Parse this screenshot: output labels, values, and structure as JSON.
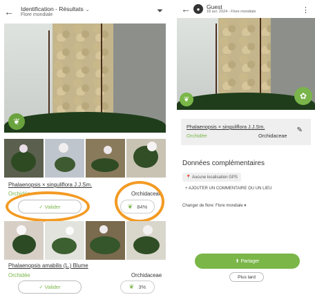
{
  "left": {
    "header": {
      "back_icon": "arrow-left-icon",
      "title": "Identification - Résultats",
      "subtitle": "Flore mondiale",
      "filter_icon": "filter-icon"
    },
    "results": [
      {
        "species": "Phalaenopsis × singuliflora J.J.Sm.",
        "genus": "Orchidée",
        "family": "Orchidaceae",
        "validate_label": "✓ Valider",
        "score": "84%"
      },
      {
        "species": "Phalaenopsis amabilis (L.) Blume",
        "genus": "Orchidée",
        "family": "Orchidaceae",
        "validate_label": "✓ Valider",
        "score": "3%"
      }
    ]
  },
  "right": {
    "header": {
      "back_icon": "arrow-left-icon",
      "user": "Guest",
      "date": "18 avr. 2024 - Flore mondiale",
      "menu_icon": "more-vertical-icon"
    },
    "card": {
      "species": "Phalaenopsis × singuliflora J.J.Sm.",
      "genus": "Orchidée",
      "family": "Orchidaceae",
      "edit_icon": "pencil-icon"
    },
    "section_title": "Données complémentaires",
    "location_chip": "Aucune localisation GPS",
    "add_comment": "+ AJOUTER UN COMMENTAIRE OU UN LIEU",
    "change_flora": "Changer de flore: Flore mondiale",
    "share_label": "Partager",
    "later_label": "Plus tard"
  },
  "colors": {
    "accent_green": "#7ab648",
    "highlight_orange": "#f39a23"
  }
}
